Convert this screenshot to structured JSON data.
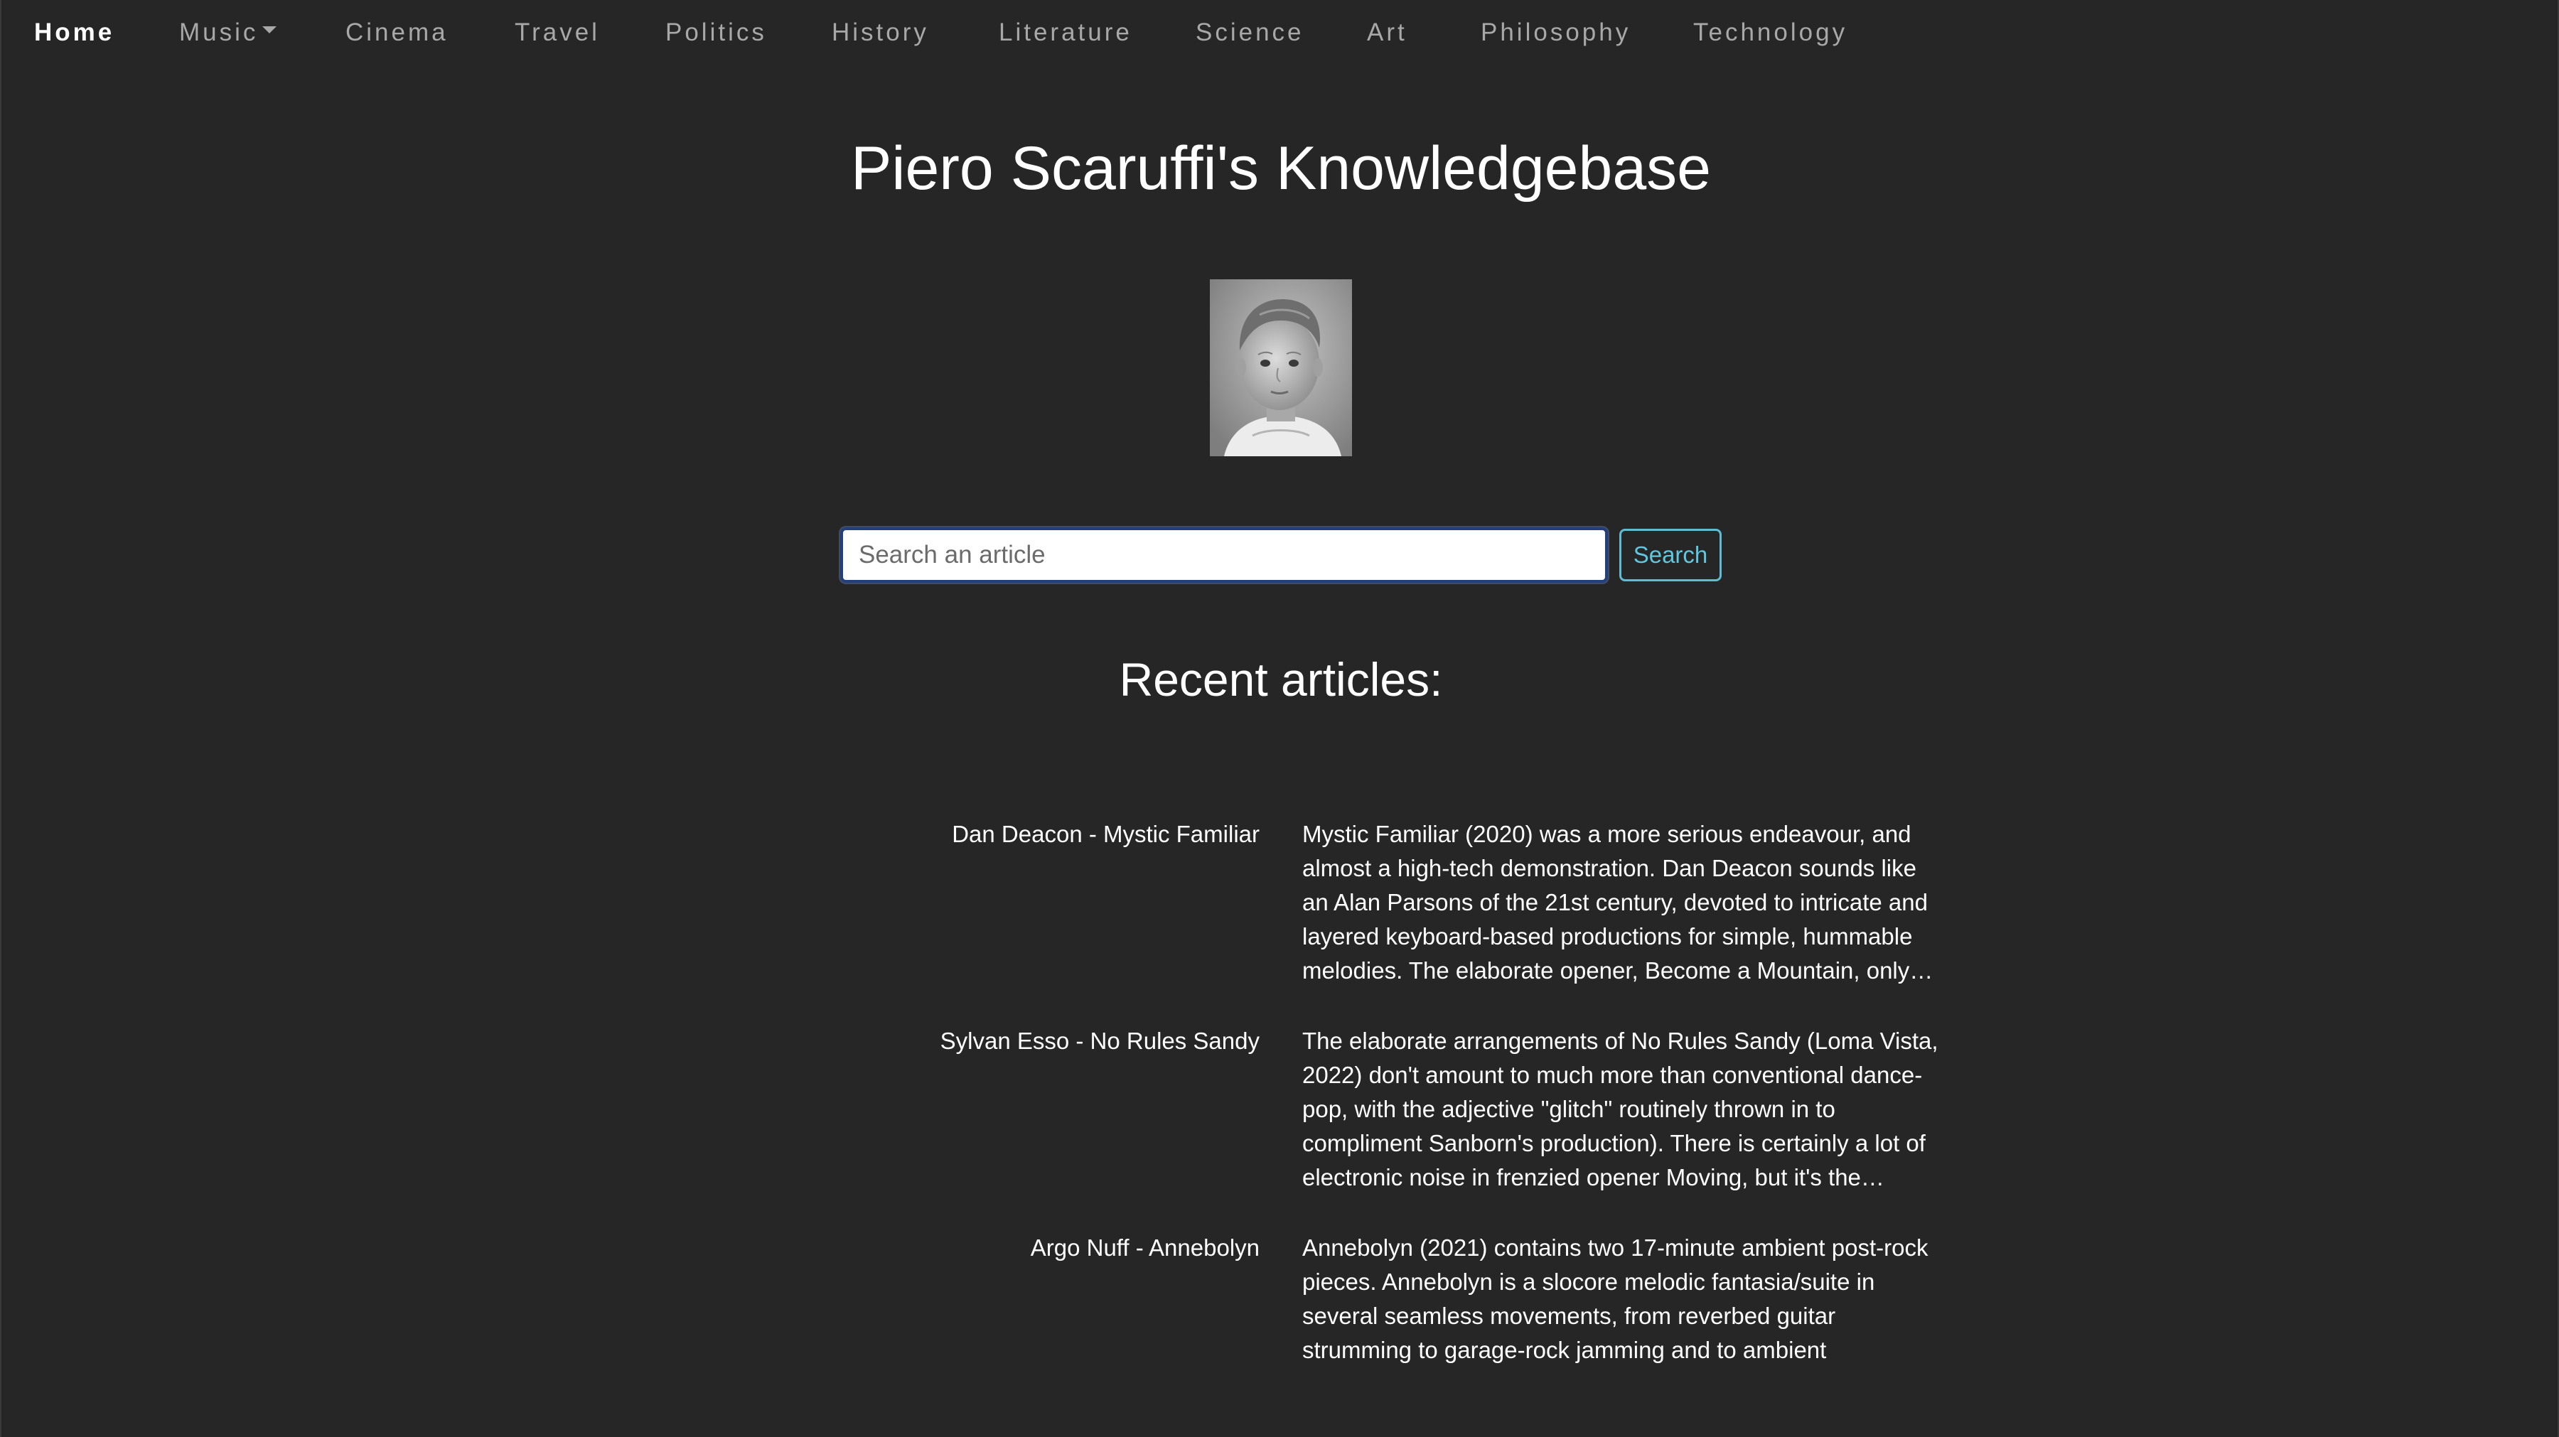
{
  "nav": {
    "items": [
      {
        "label": "Home",
        "active": true
      },
      {
        "label": "Music",
        "dropdown": true
      },
      {
        "label": "Cinema"
      },
      {
        "label": "Travel"
      },
      {
        "label": "Politics"
      },
      {
        "label": "History"
      },
      {
        "label": "Literature"
      },
      {
        "label": "Science"
      },
      {
        "label": "Art"
      },
      {
        "label": "Philosophy"
      },
      {
        "label": "Technology"
      }
    ]
  },
  "header": {
    "title": "Piero Scaruffi's Knowledgebase"
  },
  "search": {
    "placeholder": "Search an article",
    "value": "",
    "button_label": "Search"
  },
  "recent": {
    "heading": "Recent articles:",
    "articles": [
      {
        "title": "Dan Deacon - Mystic Familiar",
        "summary": "Mystic Familiar (2020) was a more serious endeavour, and almost a high-tech demonstration. Dan Deacon sounds like an Alan Parsons of the 21st century, devoted to intricate and layered keyboard-based productions for simple, hummable melodies. The elaborate opener, Become a Mountain, only employs pianos but its arrangement is dense and majestic."
      },
      {
        "title": "Sylvan Esso - No Rules Sandy",
        "summary": "The elaborate arrangements of No Rules Sandy (Loma Vista, 2022) don't amount to much more than conventional dance-pop, with the adjective \"glitch\" routinely thrown in to compliment Sanborn's production). There is certainly a lot of electronic noise in frenzied opener Moving, but it's the exception rather than the rule on this album."
      },
      {
        "title": "Argo Nuff - Annebolyn",
        "summary": "Annebolyn (2021) contains two 17-minute ambient post-rock pieces. Annebolyn is a slocore melodic fantasia/suite in several seamless movements, from reverbed guitar strumming to garage-rock jamming and to ambient electronica with low-level noise and distant voices."
      }
    ]
  },
  "colors": {
    "background": "#262626",
    "search_button_accent": "#5fc8e0",
    "input_focus_border": "#24407a"
  },
  "icons": {
    "music_dropdown": "chevron-down-icon"
  }
}
